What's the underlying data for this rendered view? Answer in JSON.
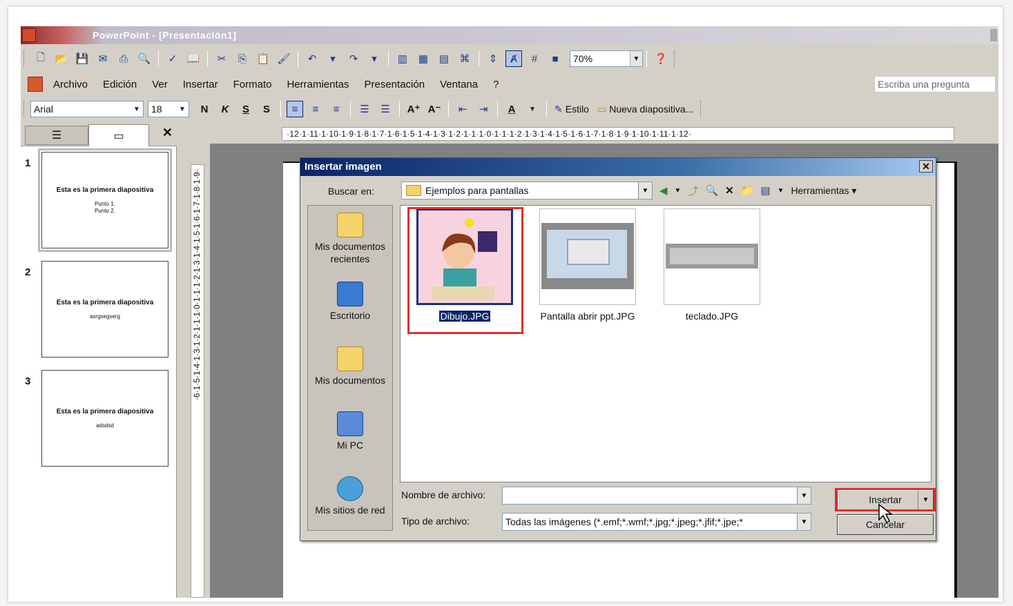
{
  "window": {
    "title": "PowerPoint - [Presentación1]"
  },
  "toolbar": {
    "zoom": "70%"
  },
  "menu": {
    "items": [
      "Archivo",
      "Edición",
      "Ver",
      "Insertar",
      "Formato",
      "Herramientas",
      "Presentación",
      "Ventana",
      "?"
    ],
    "ask_placeholder": "Escriba una pregunta"
  },
  "format_bar": {
    "font": "Arial",
    "size": "18",
    "bold": "N",
    "italic": "K",
    "underline": "S",
    "shadow": "S",
    "style_label": "Estilo",
    "new_slide_label": "Nueva diapositiva..."
  },
  "slides": [
    {
      "num": "1",
      "title": "Esta es la primera diapositiva",
      "body": "Punto 1.\nPunto 2."
    },
    {
      "num": "2",
      "title": "Esta es la primera diapositiva",
      "body": "asrgsegserg"
    },
    {
      "num": "3",
      "title": "Esta es la primera diapositiva",
      "body": "adsdsd"
    }
  ],
  "ruler": {
    "h": "·12·1·11·1·10·1·9·1·8·1·7·1·6·1·5·1·4·1·3·1·2·1·1·1·0·1·1·1·2·1·3·1·4·1·5·1·6·1·7·1·8·1·9·1·10·1·11·1·12·",
    "v": "·6·1·5·1·4·1·3·1·2·1·1·1·0·1·1·1·2·1·3·1·4·1·5·1·6·1·7·1·8·1·9·"
  },
  "dialog": {
    "title": "Insertar imagen",
    "look_in_label": "Buscar en:",
    "look_in_value": "Ejemplos para pantallas",
    "tools_label": "Herramientas",
    "places": [
      "Mis documentos recientes",
      "Escritorio",
      "Mis documentos",
      "Mi PC",
      "Mis sitios de red"
    ],
    "files": [
      "Dibujo.JPG",
      "Pantalla abrir ppt.JPG",
      "teclado.JPG"
    ],
    "filename_label": "Nombre de archivo:",
    "filename_value": "",
    "filetype_label": "Tipo de archivo:",
    "filetype_value": "Todas las imágenes (*.emf;*.wmf;*.jpg;*.jpeg;*.jfif;*.jpe;*",
    "insert_label": "Insertar",
    "cancel_label": "Cancelar"
  },
  "colors": {
    "dialog_title": "#0a246a",
    "highlight": "#e03030",
    "selection": "#0a246a"
  }
}
